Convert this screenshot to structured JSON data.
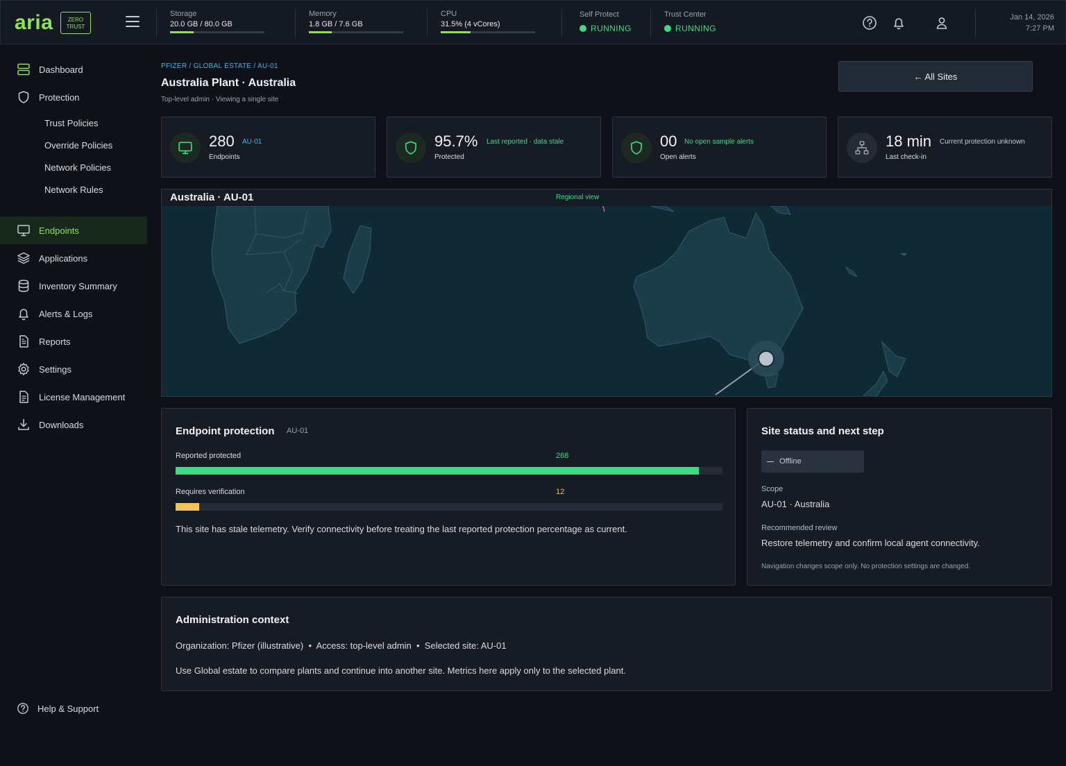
{
  "brand": {
    "logo": "aria",
    "badge_line1": "ZERO",
    "badge_line2": "TRUST"
  },
  "topbar": {
    "metrics": [
      {
        "label": "Storage",
        "value": "20.0 GB / 80.0 GB",
        "fill": 0.25
      },
      {
        "label": "Memory",
        "value": "1.8 GB / 7.6 GB",
        "fill": 0.24
      },
      {
        "label": "CPU",
        "value": "31.5% (4 vCores)",
        "fill": 0.315
      }
    ],
    "services": [
      {
        "label": "Self Protect",
        "status": "RUNNING"
      },
      {
        "label": "Trust Center",
        "status": "RUNNING"
      }
    ],
    "date": "Jan 14, 2026",
    "time": "7:27 PM"
  },
  "sidebar": {
    "items": [
      {
        "label": "Dashboard",
        "icon": "dashboard-icon"
      },
      {
        "label": "Protection",
        "icon": "shield-icon"
      },
      {
        "label": "Endpoints",
        "icon": "monitor-icon",
        "active": true
      },
      {
        "label": "Applications",
        "icon": "layers-icon"
      },
      {
        "label": "Inventory Summary",
        "icon": "database-icon"
      },
      {
        "label": "Alerts & Logs",
        "icon": "bell-icon"
      },
      {
        "label": "Reports",
        "icon": "document-icon"
      },
      {
        "label": "Settings",
        "icon": "gear-icon"
      },
      {
        "label": "License Management",
        "icon": "license-icon"
      },
      {
        "label": "Downloads",
        "icon": "download-icon"
      }
    ],
    "sub_items": [
      "Trust Policies",
      "Override Policies",
      "Network Policies",
      "Network Rules"
    ],
    "help": "Help & Support"
  },
  "page": {
    "breadcrumb": "PFIZER / GLOBAL ESTATE / AU-01",
    "title": "Australia Plant · Australia",
    "subtitle": "Top-level admin · Viewing a single site",
    "back_button": "← All Sites"
  },
  "kpis": [
    {
      "value": "280",
      "note": "AU-01",
      "label": "Endpoints"
    },
    {
      "value": "95.7%",
      "note": "Last reported · data stale",
      "label": "Protected"
    },
    {
      "value": "00",
      "note": "No open sample alerts",
      "label": "Open alerts"
    },
    {
      "value": "18 min",
      "note": "Current protection unknown",
      "label": "Last check-in"
    }
  ],
  "map": {
    "title": "Australia · AU-01",
    "view": "Regional view"
  },
  "endpoint_protection": {
    "title": "Endpoint protection",
    "site": "AU-01",
    "bars": [
      {
        "label": "Reported protected",
        "count": "268",
        "fraction": 0.957,
        "color": "#3ddc84"
      },
      {
        "label": "Requires verification",
        "count": "12",
        "fraction": 0.043,
        "color": "#f5c15c"
      }
    ],
    "message": "This site has stale telemetry. Verify connectivity before treating the last reported protection percentage as current."
  },
  "site_status": {
    "title": "Site status and next step",
    "status": "Offline",
    "scope_label": "Scope",
    "scope_value": "AU-01 · Australia",
    "review_label": "Recommended review",
    "review_value": "Restore telemetry and confirm local agent connectivity.",
    "note": "Navigation changes scope only. No protection settings are changed."
  },
  "admin": {
    "title": "Administration context",
    "line1": "Organization: Pfizer (illustrative)  •  Access: top-level admin  •  Selected site: AU-01",
    "line2": "Use Global estate to compare plants and continue into another site. Metrics here apply only to the selected plant."
  }
}
